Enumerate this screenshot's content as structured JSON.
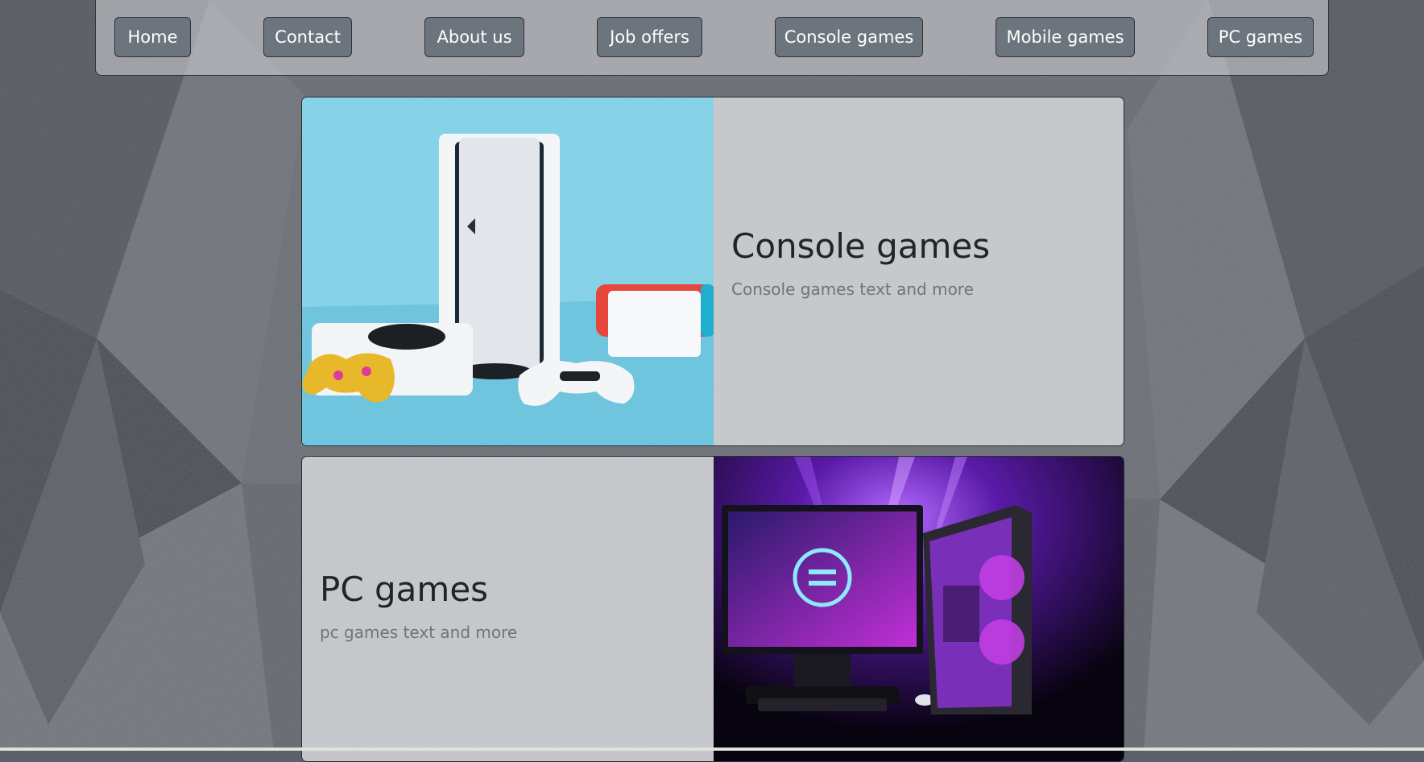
{
  "nav": {
    "items": [
      {
        "label": "Home"
      },
      {
        "label": "Contact"
      },
      {
        "label": "About us"
      },
      {
        "label": "Job offers"
      },
      {
        "label": "Console games"
      },
      {
        "label": "Mobile games"
      },
      {
        "label": "PC games"
      }
    ]
  },
  "cards": [
    {
      "title": "Console games",
      "text": "Console games text and more",
      "image": "consoles-photo"
    },
    {
      "title": "PC games",
      "text": "pc games text and more",
      "image": "gaming-pc-photo"
    }
  ],
  "colors": {
    "nav_button_bg": "#6c757d",
    "nav_button_text": "#ffffff",
    "title_text": "#212529",
    "muted_text": "#6c757d",
    "console_image_bg": "#7fd0e6",
    "pc_image_bg": "#0b0516"
  }
}
